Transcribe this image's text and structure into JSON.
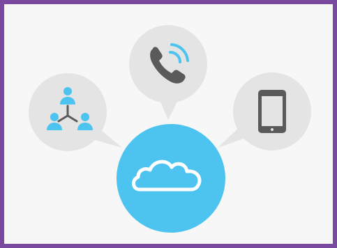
{
  "colors": {
    "frame": "#7a4aa0",
    "background": "#f7f7f7",
    "bubble": "#e4e4e4",
    "accent": "#4dc3ef",
    "icon_dark": "#5a5a5a"
  },
  "icons": {
    "left": "people-network-icon",
    "top": "phone-icon",
    "right": "smartphone-icon",
    "center": "cloud-icon"
  }
}
